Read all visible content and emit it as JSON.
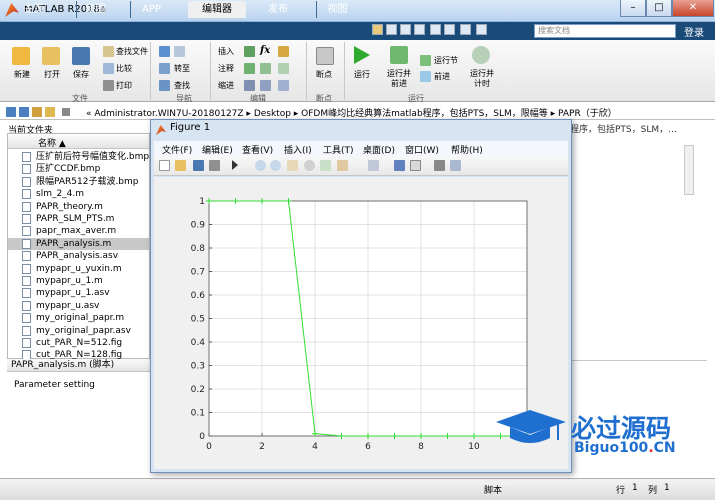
{
  "window": {
    "title": "MATLAB R2018a",
    "minimize": "–",
    "maximize": "□",
    "close": "✕"
  },
  "tabs": [
    "主页",
    "绘图",
    "APP",
    "编辑器",
    "发布",
    "视图"
  ],
  "search": {
    "placeholder": "搜索文档"
  },
  "login": "登录",
  "ribbon": {
    "new": "新建",
    "open": "打开",
    "save": "保存",
    "find_files": "查找文件",
    "compare": "比较",
    "print": "打印",
    "goto": "转至",
    "find": "查找",
    "insert": "插入",
    "fx": "fx",
    "comment": "注释",
    "indent": "缩进",
    "breakpoint": "断点",
    "run": "运行",
    "run_advance": "运行并\n前进",
    "run_section": "运行节",
    "advance": "前进",
    "run_time": "运行并\n计时",
    "groups": {
      "file": "文件",
      "nav": "导航",
      "edit": "编辑",
      "breakpoints": "断点",
      "run": "运行"
    }
  },
  "address": "« Administrator.WIN7U-20180127Z  ▸  Desktop  ▸  OFDM峰均比经典算法matlab程序，包括PTS，SLM，限幅等  ▸  PAPR（于欣）",
  "current_folder": {
    "title": "当前文件夹",
    "column": "名称 ▲",
    "files": [
      "压扩前后符号幅值变化.bmp",
      "压扩CCDF.bmp",
      "限幅PAR512子载波.bmp",
      "slm_2_4.m",
      "PAPR_theory.m",
      "PAPR_SLM_PTS.m",
      "papr_max_aver.m",
      "PAPR_analysis.m",
      "PAPR_analysis.asv",
      "mypapr_u_yuxin.m",
      "mypapr_u_1.m",
      "mypapr_u_1.asv",
      "mypapr_u.asv",
      "my_original_papr.m",
      "my_original_papr.asv",
      "cut_PAR_N=512.fig",
      "cut_PAR_N=128.fig"
    ],
    "selected_index": 7
  },
  "details": {
    "header": "PAPR_analysis.m  (脚本)",
    "text": "Parameter setting"
  },
  "editor_header": "程序，包括PTS，SLM，...",
  "status": {
    "mode": "脚本",
    "row_label": "行",
    "row": "1",
    "col_label": "列",
    "col": "1"
  },
  "figure": {
    "title": "Figure 1",
    "menus": [
      "文件(F)",
      "编辑(E)",
      "查看(V)",
      "插入(I)",
      "工具(T)",
      "桌面(D)",
      "窗口(W)",
      "帮助(H)"
    ]
  },
  "chart_data": {
    "type": "line",
    "x": [
      0,
      1,
      2,
      3,
      4,
      5,
      6,
      7,
      8,
      9,
      10,
      11,
      12
    ],
    "y": [
      1,
      1,
      1,
      1,
      0.01,
      0,
      0,
      0,
      0,
      0,
      0,
      0,
      0
    ],
    "xlim": [
      0,
      12
    ],
    "ylim": [
      0,
      1
    ],
    "xticks": [
      0,
      2,
      4,
      6,
      8,
      10
    ],
    "yticks": [
      0,
      0.1,
      0.2,
      0.3,
      0.4,
      0.5,
      0.6,
      0.7,
      0.8,
      0.9,
      1
    ],
    "grid": true,
    "marker": "+",
    "color": "#33dd33"
  },
  "watermark": {
    "text": "必过源码",
    "url_prefix": "Biguo100",
    "url_dot": ".",
    "url_suffix": "CN"
  }
}
